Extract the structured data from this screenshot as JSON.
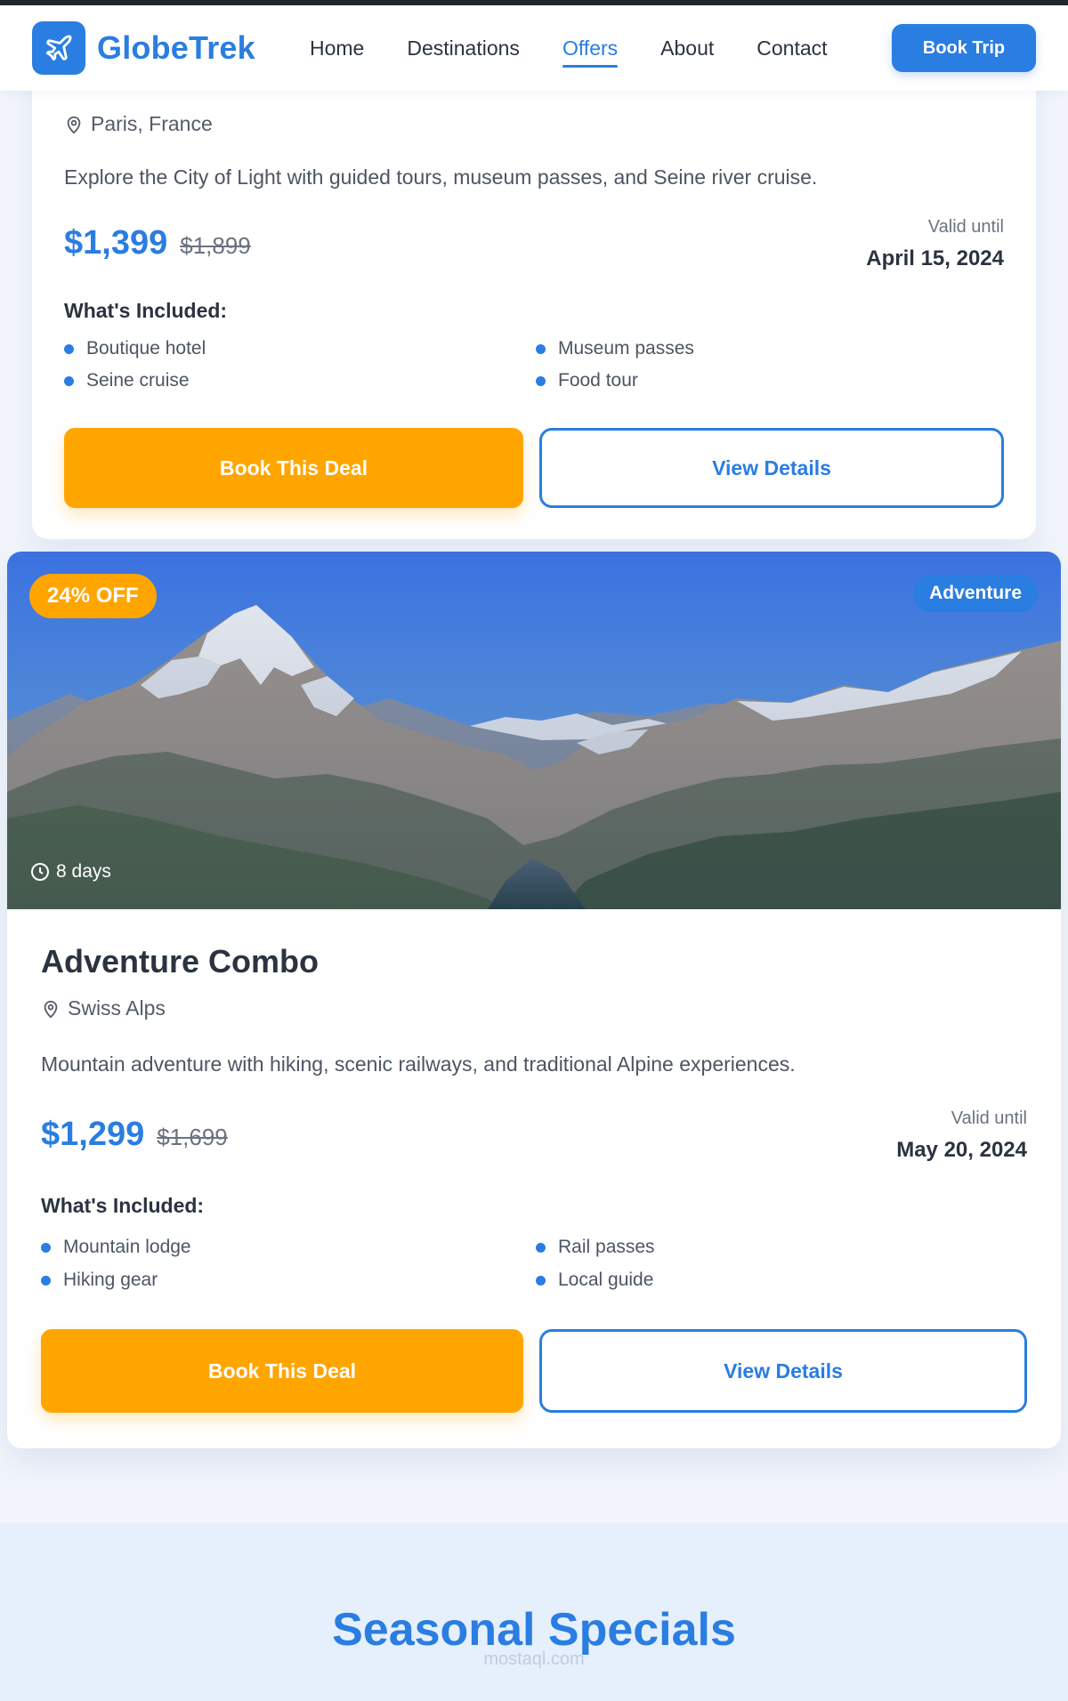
{
  "header": {
    "brand": "GlobeTrek",
    "nav": [
      "Home",
      "Destinations",
      "Offers",
      "About",
      "Contact"
    ],
    "active_nav": "Offers",
    "cta": "Book Trip",
    "accent_color": "#2a7de1"
  },
  "offers": [
    {
      "location": "Paris, France",
      "description": "Explore the City of Light with guided tours, museum passes, and Seine river cruise.",
      "price": "$1,399",
      "old_price": "$1,899",
      "valid_label": "Valid until",
      "valid_date": "April 15, 2024",
      "included_title": "What's Included:",
      "features": [
        "Boutique hotel",
        "Museum passes",
        "Seine cruise",
        "Food tour"
      ],
      "book_label": "Book This Deal",
      "details_label": "View Details"
    },
    {
      "discount_badge": "24% OFF",
      "category": "Adventure",
      "duration": "8 days",
      "title": "Adventure Combo",
      "location": "Swiss Alps",
      "description": "Mountain adventure with hiking, scenic railways, and traditional Alpine experiences.",
      "price": "$1,299",
      "old_price": "$1,699",
      "valid_label": "Valid until",
      "valid_date": "May 20, 2024",
      "included_title": "What's Included:",
      "features": [
        "Mountain lodge",
        "Rail passes",
        "Hiking gear",
        "Local guide"
      ],
      "book_label": "Book This Deal",
      "details_label": "View Details"
    }
  ],
  "seasonal": {
    "title": "Seasonal Specials",
    "watermark": "mostaql.com"
  },
  "colors": {
    "primary": "#2a7de1",
    "orange": "#ffa500",
    "text_dark": "#2b3340"
  }
}
